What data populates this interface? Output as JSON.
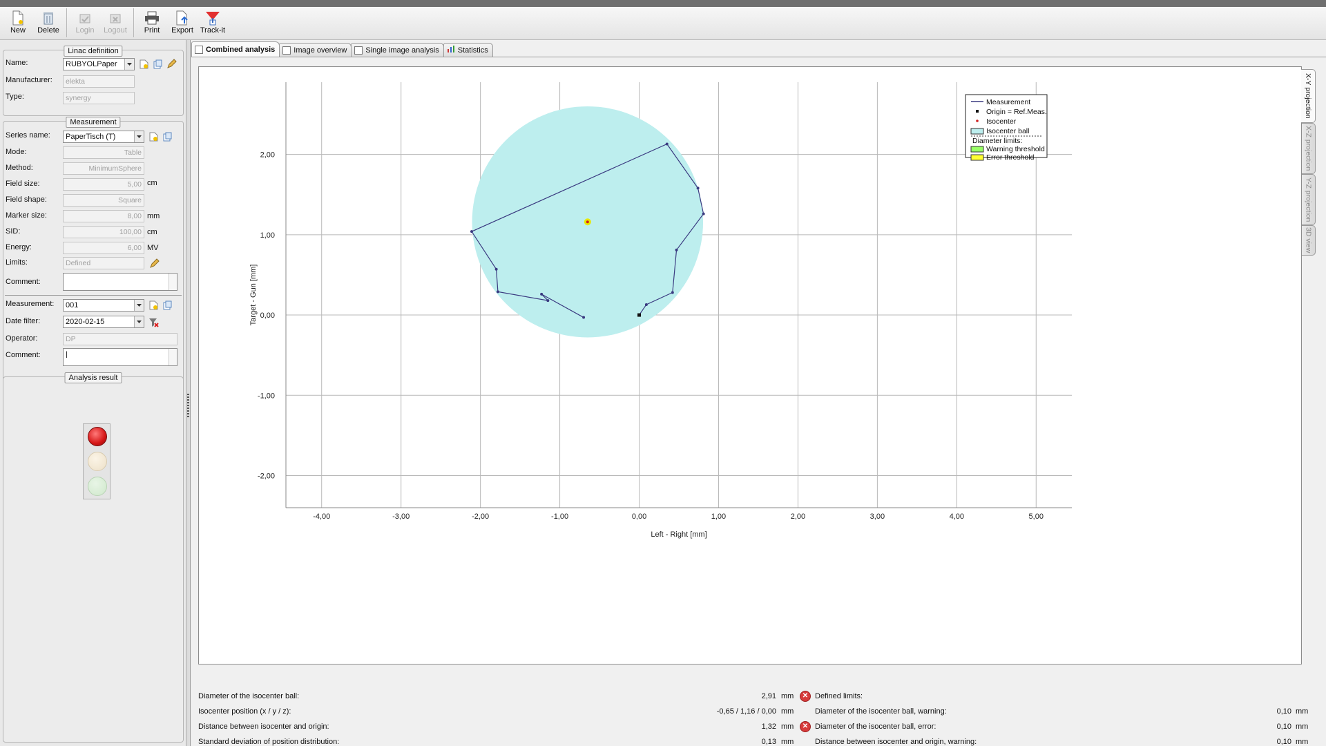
{
  "toolbar": {
    "new": "New",
    "delete": "Delete",
    "login": "Login",
    "logout": "Logout",
    "print": "Print",
    "export": "Export",
    "trackit": "Track-it"
  },
  "linac": {
    "title": "Linac definition",
    "name_label": "Name:",
    "name_value": "RUBYOLPaper",
    "manufacturer_label": "Manufacturer:",
    "manufacturer_value": "elekta",
    "type_label": "Type:",
    "type_value": "synergy"
  },
  "measurement": {
    "title": "Measurement",
    "series_label": "Series name:",
    "series_value": "PaperTisch (T)",
    "mode_label": "Mode:",
    "mode_value": "Table",
    "method_label": "Method:",
    "method_value": "MinimumSphere",
    "fieldsize_label": "Field size:",
    "fieldsize_value": "5,00",
    "fieldsize_unit": "cm",
    "fieldshape_label": "Field shape:",
    "fieldshape_value": "Square",
    "marker_label": "Marker size:",
    "marker_value": "8,00",
    "marker_unit": "mm",
    "sid_label": "SID:",
    "sid_value": "100,00",
    "sid_unit": "cm",
    "energy_label": "Energy:",
    "energy_value": "6,00",
    "energy_unit": "MV",
    "limits_label": "Limits:",
    "limits_value": "Defined",
    "comment_label": "Comment:",
    "comment_value": "",
    "meas_label": "Measurement:",
    "meas_value": "001",
    "datefilter_label": "Date filter:",
    "datefilter_value": "2020-02-15",
    "operator_label": "Operator:",
    "operator_value": "DP",
    "comment2_label": "Comment:",
    "comment2_value": "|"
  },
  "analysis": {
    "title": "Analysis result",
    "status": "error"
  },
  "tabs": [
    {
      "label": "Combined analysis"
    },
    {
      "label": "Image overview"
    },
    {
      "label": "Single image analysis"
    },
    {
      "label": "Statistics"
    }
  ],
  "sidetabs": [
    {
      "label": "X-Y projection"
    },
    {
      "label": "X-Z projection"
    },
    {
      "label": "Y-Z projection"
    },
    {
      "label": "3D view"
    }
  ],
  "chart_data": {
    "type": "scatter",
    "title": "",
    "xlabel": "Left - Right [mm]",
    "ylabel": "Target - Gun [mm]",
    "xlim": [
      -4.45,
      5.45
    ],
    "ylim": [
      -2.4,
      2.9
    ],
    "xticks": [
      "-4,00",
      "-3,00",
      "-2,00",
      "-1,00",
      "0,00",
      "1,00",
      "2,00",
      "3,00",
      "4,00",
      "5,00"
    ],
    "xtick_values": [
      -4,
      -3,
      -2,
      -1,
      0,
      1,
      2,
      3,
      4,
      5
    ],
    "yticks": [
      "-2,00",
      "-1,00",
      "0,00",
      "1,00",
      "2,00"
    ],
    "ytick_values": [
      -2,
      -1,
      0,
      1,
      2
    ],
    "grid": true,
    "legend_position": "top-right",
    "series": [
      {
        "name": "Measurement",
        "color": "#3a3a80",
        "x": [
          0.0,
          0.09,
          0.42,
          0.47,
          0.81,
          0.74,
          0.35,
          -2.11,
          -1.8,
          -1.78,
          -1.15,
          -1.23,
          -0.7
        ],
        "y": [
          0.0,
          0.13,
          0.28,
          0.81,
          1.26,
          1.58,
          2.13,
          1.04,
          0.57,
          0.29,
          0.18,
          0.26,
          -0.03
        ]
      }
    ],
    "origin": {
      "name": "Origin = Ref.Meas.",
      "x": 0.0,
      "y": 0.0
    },
    "isocenter": {
      "name": "Isocenter",
      "x": -0.65,
      "y": 1.16
    },
    "isocenter_ball": {
      "name": "Isocenter ball",
      "diameter": 2.91,
      "color": "#bdeeee"
    },
    "legend": {
      "measurement": "Measurement",
      "origin": "Origin = Ref.Meas.",
      "isocenter": "Isocenter",
      "ball": "Isocenter ball",
      "diam": "Diameter limits:",
      "warning": "Warning threshold",
      "error": "Error threshold",
      "warning_color": "#99ff66",
      "error_color": "#ffff33"
    }
  },
  "results": {
    "left": [
      {
        "label": "Diameter of the isocenter ball:",
        "value": "2,91",
        "unit": "mm",
        "flag": true
      },
      {
        "label": "Isocenter position (x / y / z):",
        "value": "-0,65 / 1,16 / 0,00",
        "unit": "mm",
        "flag": false
      },
      {
        "label": "Distance between isocenter and origin:",
        "value": "1,32",
        "unit": "mm",
        "flag": true
      },
      {
        "label": "Standard deviation of position distribution:",
        "value": "0,13",
        "unit": "mm",
        "flag": false
      }
    ],
    "right": [
      {
        "label": "Defined limits:",
        "value": "",
        "unit": ""
      },
      {
        "label": "Diameter of the isocenter ball, warning:",
        "value": "0,10",
        "unit": "mm"
      },
      {
        "label": "Diameter of the isocenter ball, error:",
        "value": "0,10",
        "unit": "mm"
      },
      {
        "label": "Distance between isocenter and origin, warning:",
        "value": "0,10",
        "unit": "mm"
      }
    ]
  }
}
